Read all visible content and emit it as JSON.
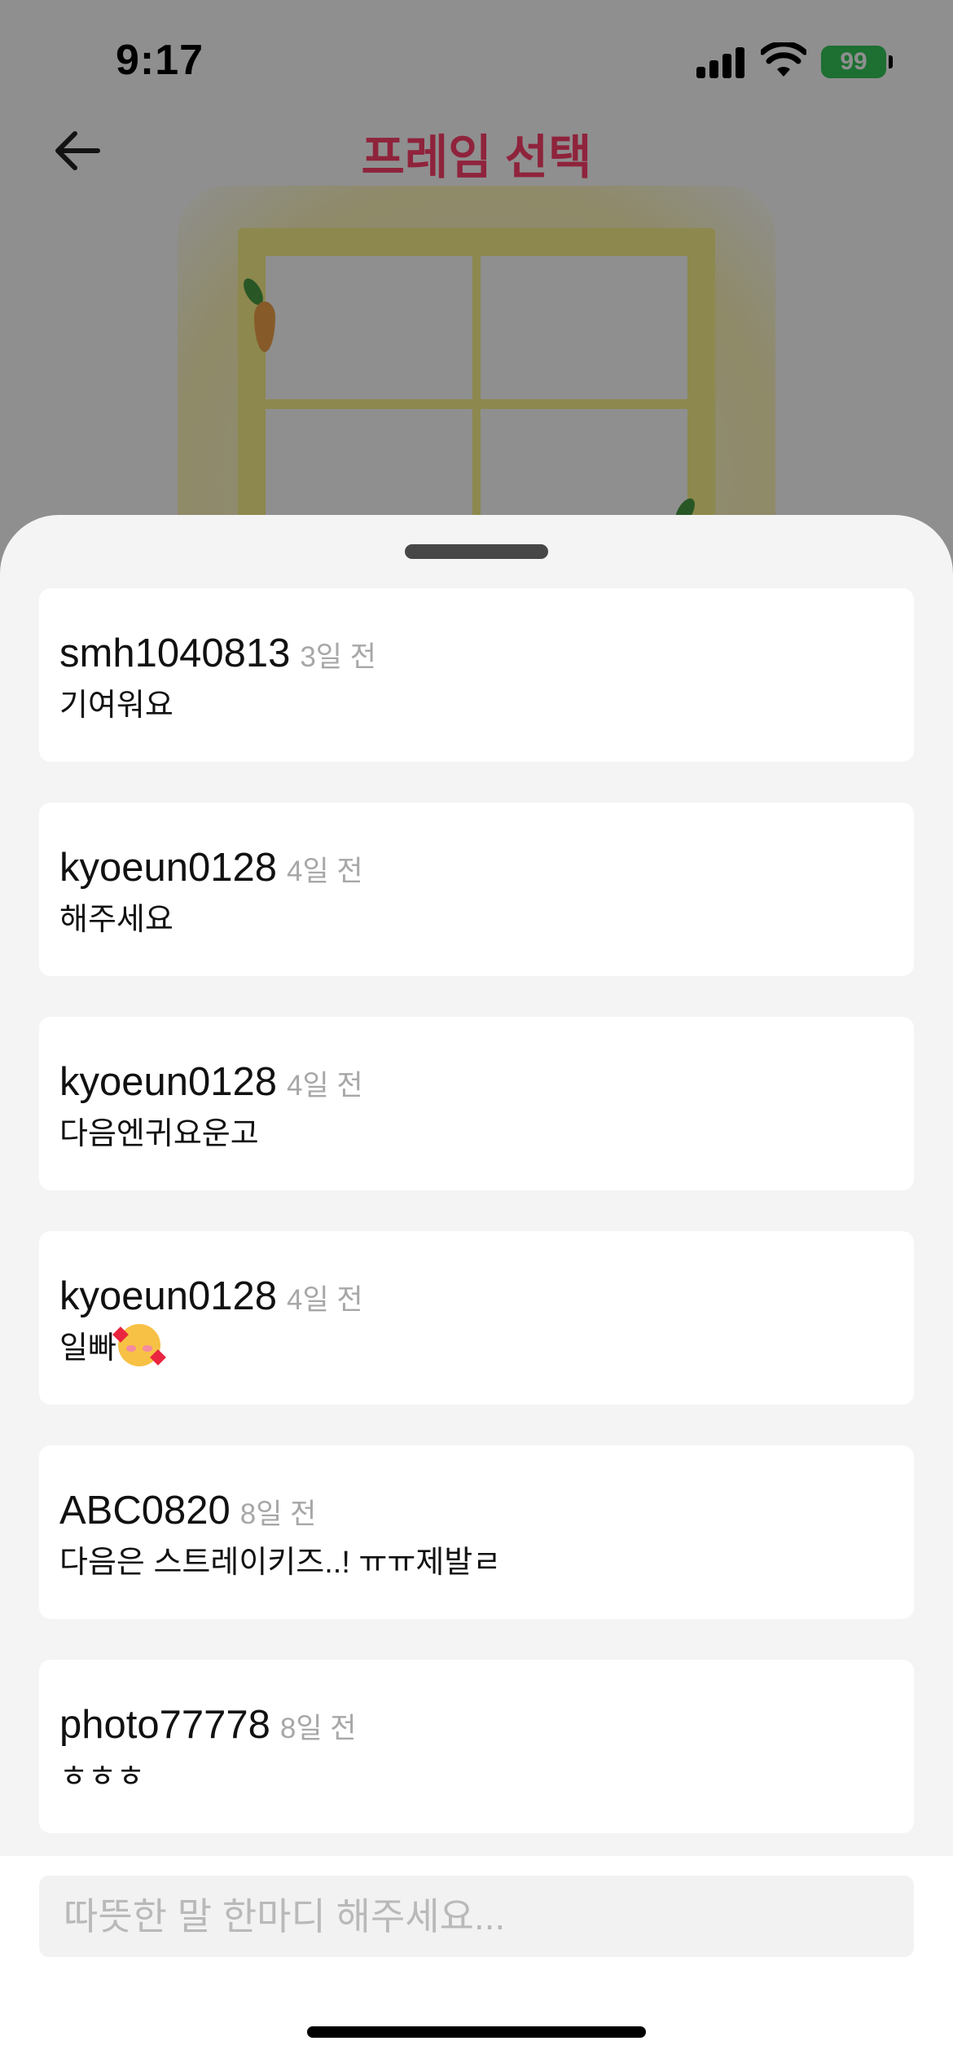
{
  "status_bar": {
    "time": "9:17",
    "battery": "99"
  },
  "background": {
    "title": "프레임 선택"
  },
  "comments": [
    {
      "user": "smh1040813",
      "time": "3일 전",
      "text": "기여워요"
    },
    {
      "user": "kyoeun0128",
      "time": "4일 전",
      "text": "해주세요"
    },
    {
      "user": "kyoeun0128",
      "time": "4일 전",
      "text": "다음엔귀요운고"
    },
    {
      "user": "kyoeun0128",
      "time": "4일 전",
      "text": "일빠",
      "emoji": "smiling-face-with-hearts-icon"
    },
    {
      "user": "ABC0820",
      "time": "8일 전",
      "text": "다음은 스트레이키즈..! ㅠㅠ제발ㄹ"
    },
    {
      "user": "photo77778",
      "time": "8일 전",
      "text": "ㅎㅎㅎ"
    }
  ],
  "input": {
    "placeholder": "따뜻한 말 한마디 해주세요..."
  },
  "colors": {
    "accent": "#ff3f6c",
    "battery": "#34c759",
    "frame": "#fbf38a"
  }
}
